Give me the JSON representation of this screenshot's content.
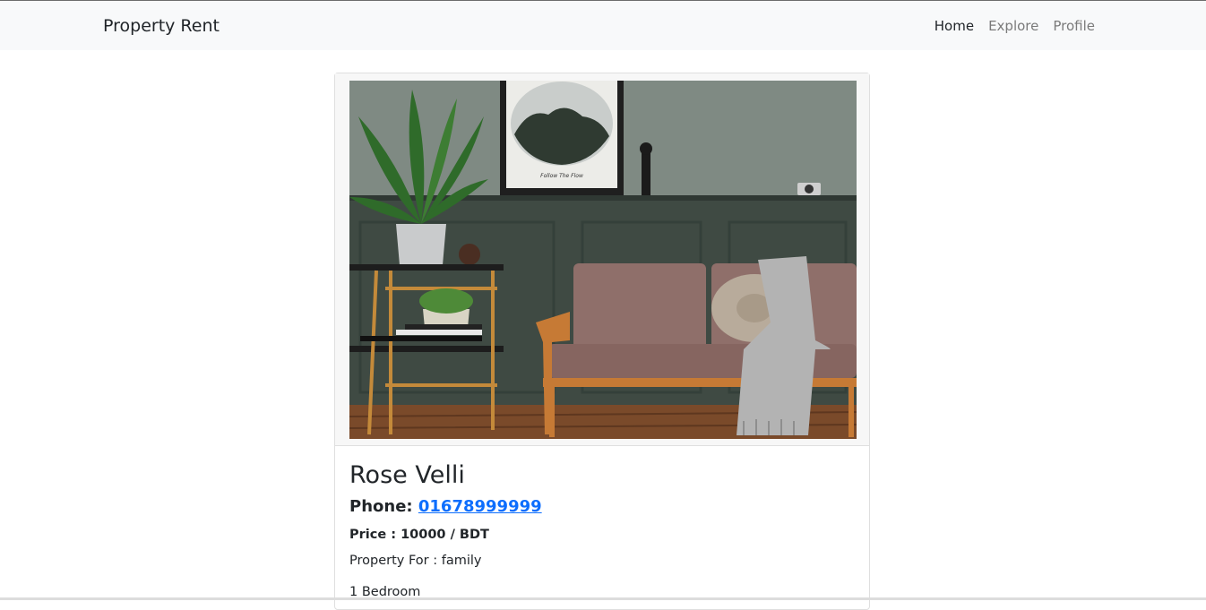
{
  "navbar": {
    "brand": "Property Rent",
    "links": [
      {
        "label": "Home",
        "active": true
      },
      {
        "label": "Explore",
        "active": false
      },
      {
        "label": "Profile",
        "active": false
      }
    ]
  },
  "property": {
    "name": "Rose Velli",
    "phone_label": "Phone:",
    "phone": "01678999999",
    "price": "Price : 10000 / BDT",
    "property_for": "Property For : family",
    "bedrooms": "1 Bedroom"
  },
  "photo": {
    "poster_caption": "Follow The Flow"
  },
  "colors": {
    "navbar_bg": "#f8f9fa",
    "link_color": "#0d6efd",
    "wall": "#3f4a43",
    "sofa": "#8f6f6a"
  }
}
